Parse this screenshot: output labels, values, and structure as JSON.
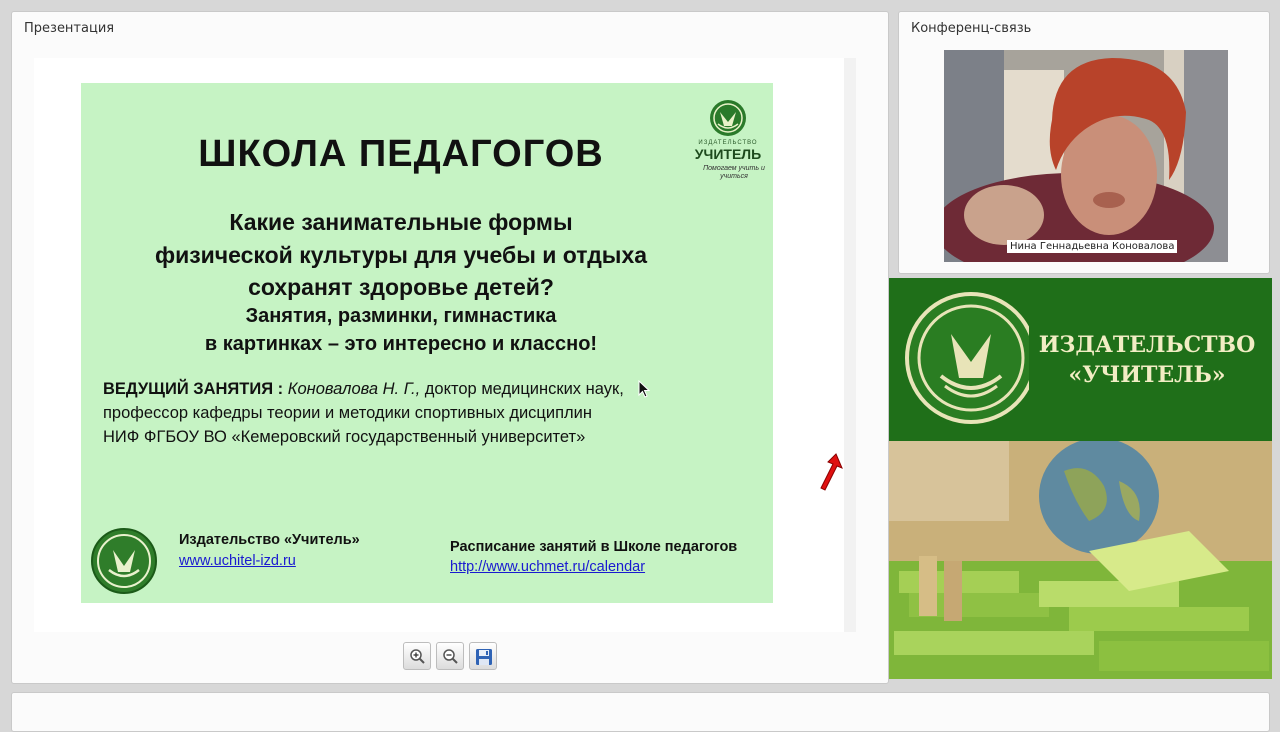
{
  "presentation_pod": {
    "title": "Презентация",
    "slide": {
      "title": "ШКОЛА ПЕДАГОГОВ",
      "question_lines": [
        "Какие занимательные формы",
        "физической культуры для учебы и отдыха",
        "сохранят здоровье детей?",
        "Занятия, разминки, гимнастика",
        "в картинках – это интересно и классно!"
      ],
      "lead_label": "ВЕДУЩИЙ ЗАНЯТИЯ : ",
      "lead_name": "Коновалова Н. Г.,",
      "lead_line1_rest": " доктор медицинских наук,",
      "lead_line2": "профессор кафедры теории и методики спортивных дисциплин",
      "lead_line3": "НИФ ФГБОУ ВО «Кемеровский государственный университет»",
      "publisher_name": "Издательство «Учитель»",
      "publisher_url": "www.uchitel-izd.ru",
      "schedule_title": "Расписание занятий в Школе педагогов",
      "schedule_url": "http://www.uchmet.ru/calendar",
      "logo_text_top": "ИЗДАТЕЛЬСТВО",
      "logo_text_main": "УЧИТЕЛЬ",
      "logo_tagline": "Помогаем учить и учиться"
    },
    "toolbar": {
      "zoom_in_icon": "zoom-in-icon",
      "zoom_out_icon": "zoom-out-icon",
      "save_icon": "save-icon"
    }
  },
  "conference_pod": {
    "title": "Конференц-связь",
    "participant_name": "Нина Геннадьевна Коновалова"
  },
  "banner": {
    "line1": "ИЗДАТЕЛЬСТВО",
    "line2": "«УЧИТЕЛЬ»"
  },
  "colors": {
    "slide_bg": "#c6f3c4",
    "banner_green": "#1f6f19",
    "link": "#1a1ad0"
  }
}
